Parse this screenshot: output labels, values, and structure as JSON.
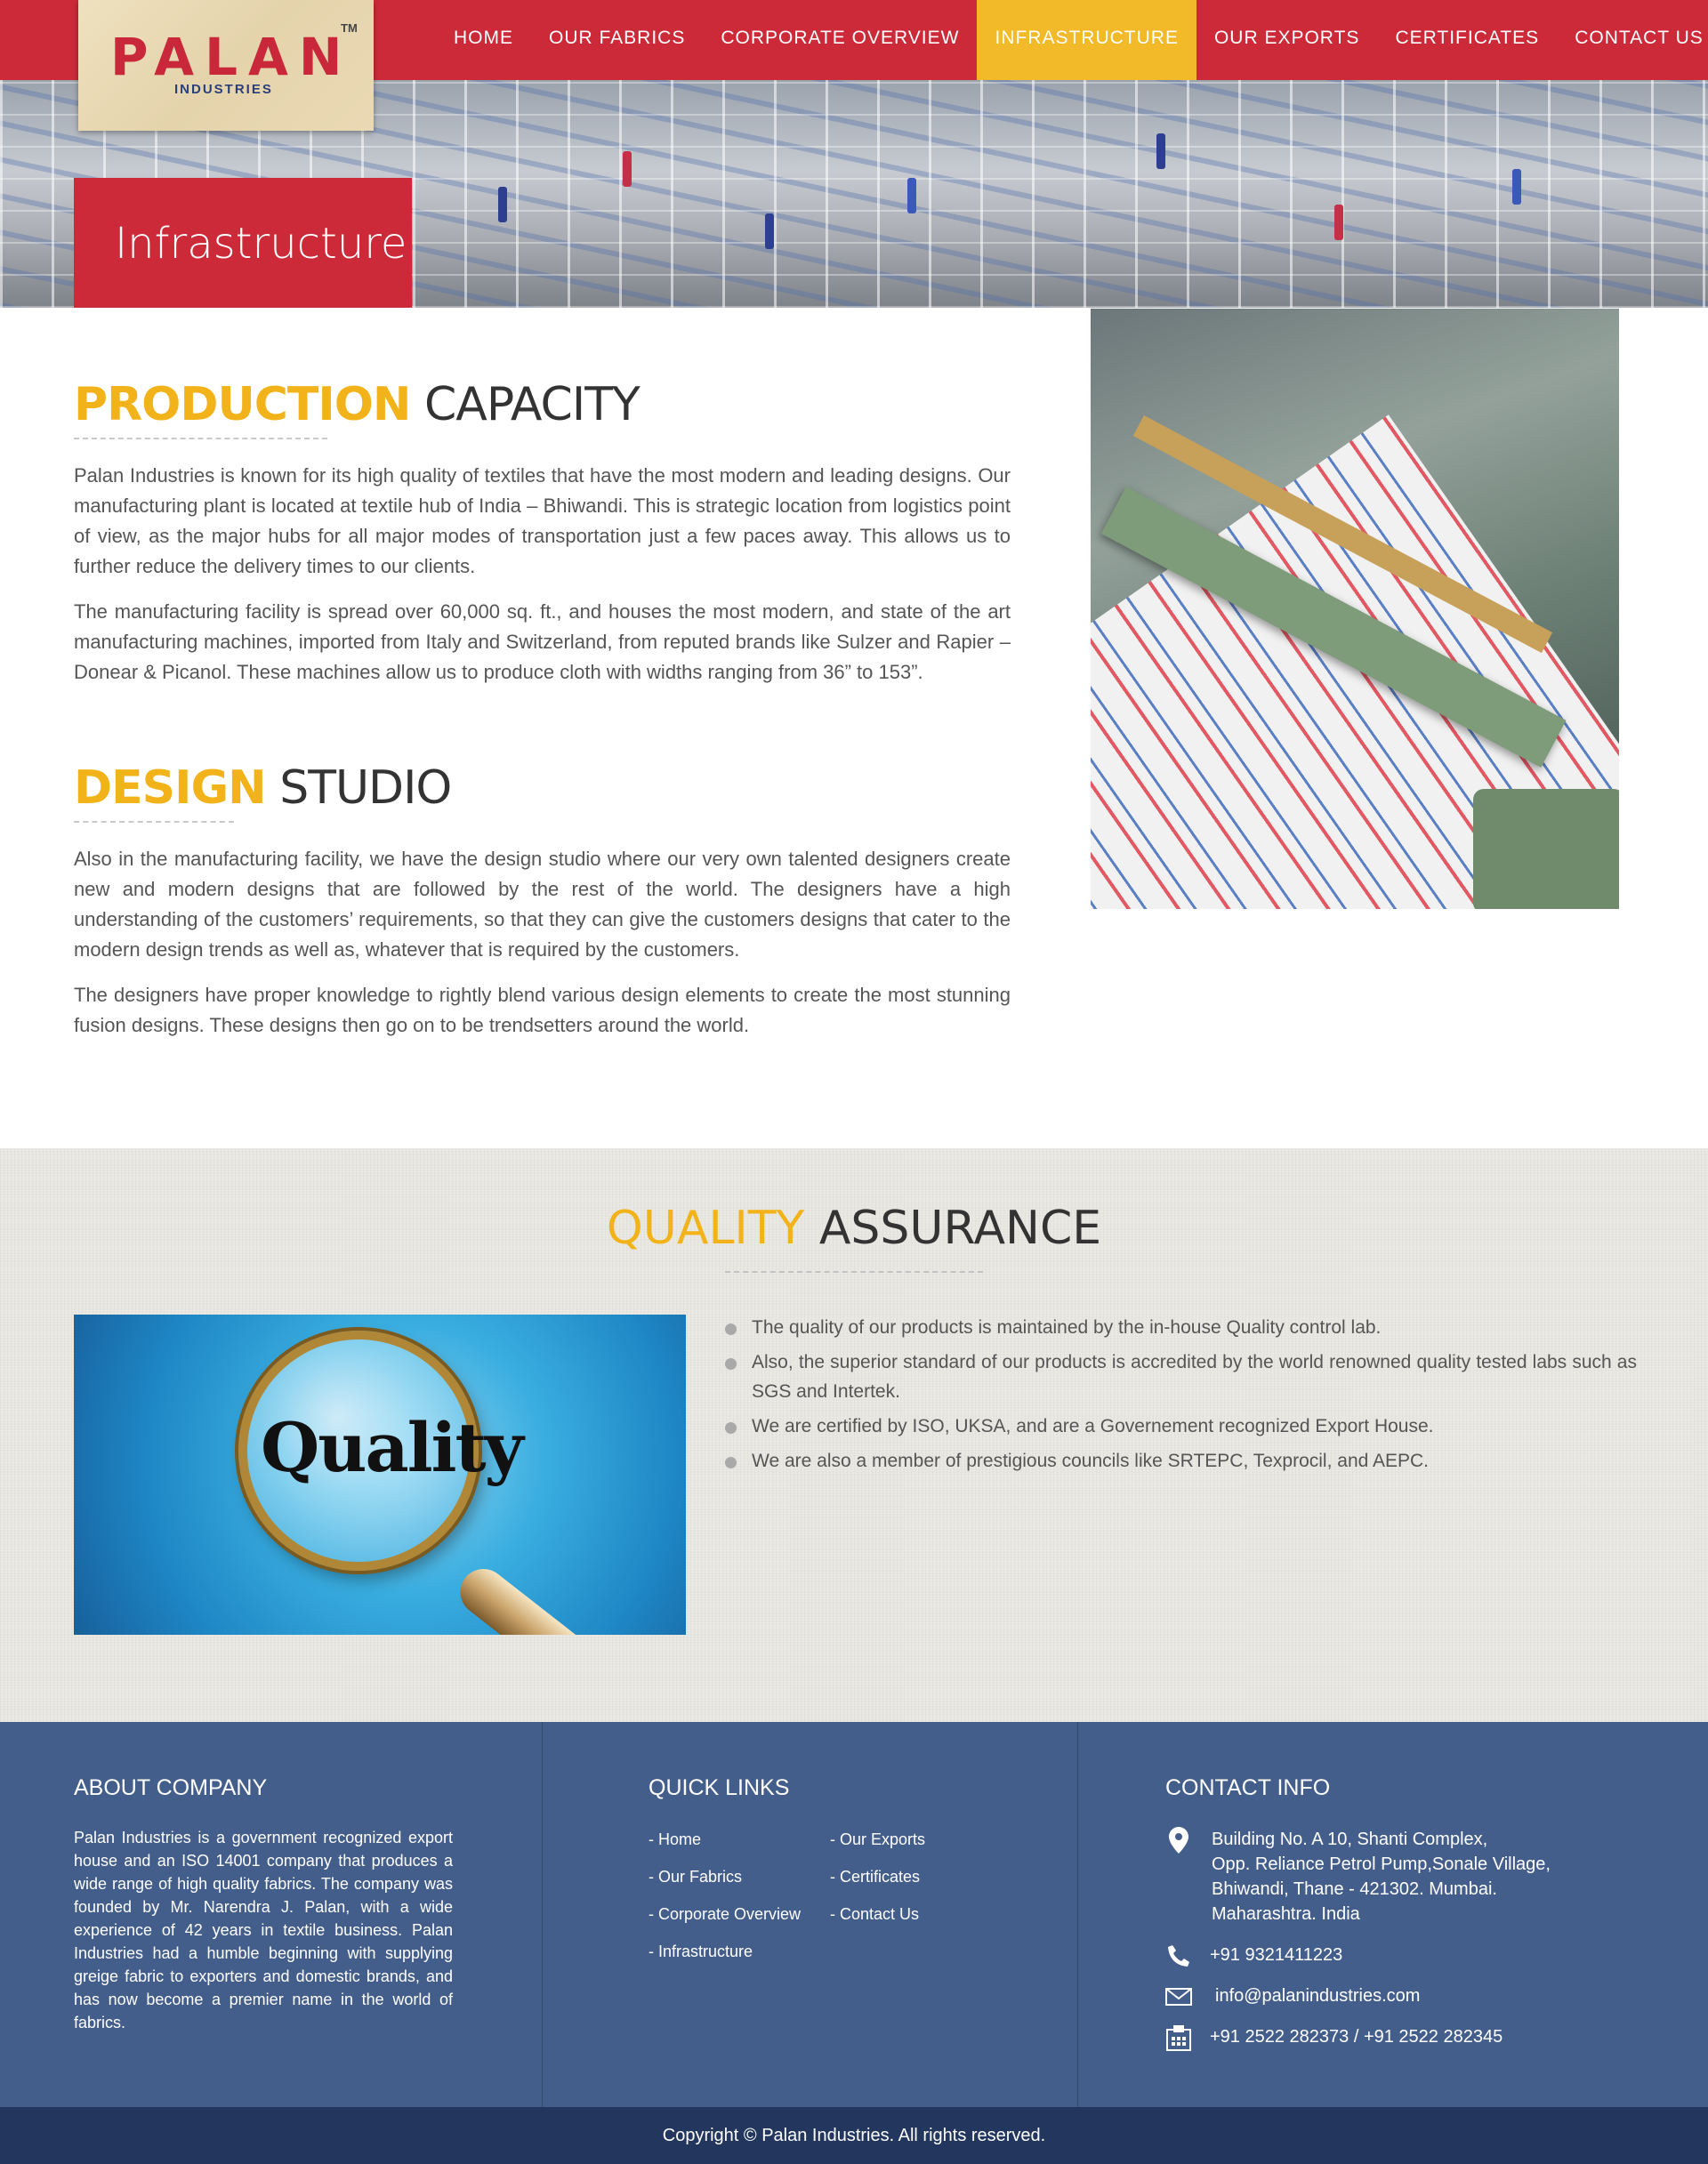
{
  "brand": {
    "name": "PALAN",
    "tm": "TM",
    "sub": "INDUSTRIES"
  },
  "nav": [
    {
      "label": "HOME"
    },
    {
      "label": "OUR FABRICS"
    },
    {
      "label": "CORPORATE OVERVIEW"
    },
    {
      "label": "INFRASTRUCTURE",
      "active": true
    },
    {
      "label": "OUR EXPORTS"
    },
    {
      "label": "CERTIFICATES"
    },
    {
      "label": "CONTACT US"
    }
  ],
  "hero": {
    "title": "Infrastructure"
  },
  "production": {
    "heading_accent": "PRODUCTION",
    "heading_rest": "CAPACITY",
    "paragraphs": [
      "Palan Industries is known for its high quality of textiles that have the most modern and leading designs. Our manufacturing plant is located at textile hub of India – Bhiwandi. This is strategic location from logistics point of view, as the major hubs for all major modes of transportation just a few paces away. This allows us to further reduce the delivery times to our clients.",
      "The manufacturing facility is spread over 60,000 sq. ft., and houses the most modern, and state of the art manufacturing machines, imported from Italy and Switzerland, from reputed brands like Sulzer and Rapier – Donear & Picanol. These machines allow us to produce cloth with widths ranging from 36” to 153”."
    ]
  },
  "design": {
    "heading_accent": "DESIGN",
    "heading_rest": "STUDIO",
    "paragraphs": [
      "Also in the manufacturing facility, we have the design studio where our very own talented designers create new and modern designs that are followed by the rest of the world. The designers have a high understanding of the customers’ requirements, so that they can give the customers designs that cater to the modern design trends as well as, whatever that is required by the customers.",
      "The designers have proper knowledge to rightly blend various design elements to create the most stunning fusion designs. These designs then go on to be trendsetters around the world."
    ]
  },
  "quality": {
    "heading_accent": "QUALITY",
    "heading_rest": "ASSURANCE",
    "image_word": "Quality",
    "items": [
      "The quality of our products is maintained by the in-house Quality control lab.",
      "Also, the superior standard of our products is accredited by the world renowned quality tested labs such as SGS and Intertek.",
      "We are certified by ISO, UKSA, and are a Governement recognized Export House.",
      "We are also a member of prestigious councils like SRTEPC, Texprocil, and AEPC."
    ]
  },
  "footer": {
    "about": {
      "heading": "ABOUT COMPANY",
      "text": "Palan Industries is a government recognized export house and an ISO 14001 company that produces a wide range of high quality fabrics. The company was founded by Mr. Narendra J. Palan, with a wide experience of 42 years in textile business. Palan Industries had a humble beginning with supplying greige fabric to exporters and domestic brands, and has now become a premier name in the world of fabrics."
    },
    "links": {
      "heading": "QUICK LINKS",
      "col1": [
        "- Home",
        "- Our Fabrics",
        "- Corporate Overview",
        "- Infrastructure"
      ],
      "col2": [
        "- Our Exports",
        "- Certificates",
        "- Contact Us"
      ]
    },
    "contact": {
      "heading": "CONTACT INFO",
      "address": [
        "Building No. A 10, Shanti Complex,",
        "Opp. Reliance Petrol Pump,Sonale Village,",
        "Bhiwandi, Thane - 421302. Mumbai.",
        "Maharashtra. India"
      ],
      "phone": "+91 9321411223",
      "email": "info@palanindustries.com",
      "fax": "+91 2522 282373 / +91 2522 282345"
    },
    "copyright": "Copyright © Palan Industries. All rights reserved."
  },
  "colors": {
    "brand_red": "#cc2a39",
    "accent_yellow": "#f2b31a",
    "footer_blue": "#445e8c",
    "copyright_blue": "#23375e"
  }
}
